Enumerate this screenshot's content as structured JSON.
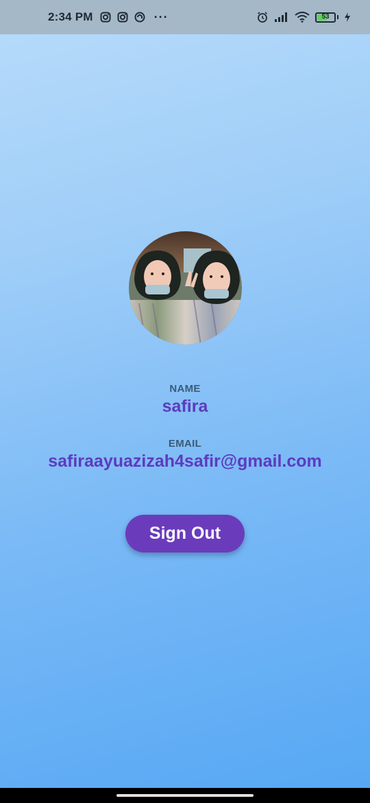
{
  "status_bar": {
    "time": "2:34 PM",
    "left_icons": [
      "instagram-icon",
      "instagram-icon",
      "threads-icon"
    ],
    "more": "···",
    "right_icons": [
      "alarm-icon",
      "signal-icon",
      "wifi-icon",
      "battery-icon",
      "charging-icon"
    ],
    "battery_level": "53",
    "battery_fraction": 0.53
  },
  "profile": {
    "avatar_alt": "profile photo",
    "name_label": "NAME",
    "name_value": "safira",
    "email_label": "EMAIL",
    "email_value": "safiraayuazizah4safir@gmail.com"
  },
  "actions": {
    "sign_out_label": "Sign Out"
  },
  "colors": {
    "accent": "#6a3cbc",
    "value_text": "#5d3bbf",
    "label_text": "#3c5a78",
    "status_bar_bg": "#a5b8c8"
  }
}
